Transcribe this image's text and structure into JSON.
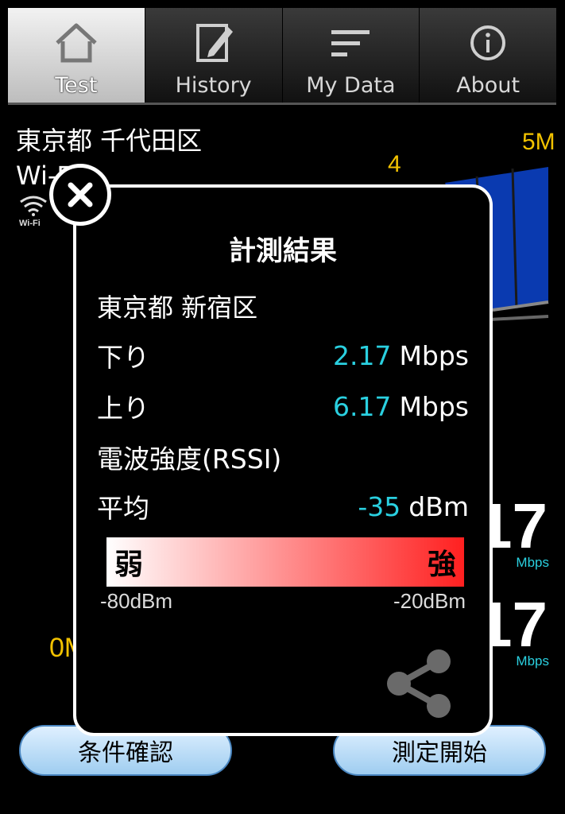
{
  "tabs": [
    {
      "label": "Test",
      "icon": "home-icon",
      "active": true
    },
    {
      "label": "History",
      "icon": "edit-icon",
      "active": false
    },
    {
      "label": "My Data",
      "icon": "list-icon",
      "active": false
    },
    {
      "label": "About",
      "icon": "info-icon",
      "active": false
    }
  ],
  "background": {
    "location": "東京都 千代田区",
    "network": "Wi-Fi",
    "wifi_label": "Wi-Fi",
    "gauge": {
      "tick_4": "4",
      "tick_5": "5M",
      "tick_0": "0M"
    },
    "download_speed_partial": "17",
    "upload_speed_partial": "17",
    "unit": "Mbps"
  },
  "buttons": {
    "check_conditions": "条件確認",
    "start_measurement": "測定開始"
  },
  "modal": {
    "title": "計測結果",
    "location": "東京都 新宿区",
    "download": {
      "label": "下り",
      "value": "2.17",
      "unit": "Mbps"
    },
    "upload": {
      "label": "上り",
      "value": "6.17",
      "unit": "Mbps"
    },
    "rssi_heading": "電波強度(RSSI)",
    "average": {
      "label": "平均",
      "value": "-35",
      "unit": "dBm"
    },
    "scale": {
      "weak": "弱",
      "strong": "強",
      "min": "-80dBm",
      "max": "-20dBm"
    }
  },
  "colors": {
    "accent": "#2ad0e0",
    "gauge_yellow": "#f2c200",
    "gauge_blue": "#0a3ab0",
    "button_fill": "#bfe0f8"
  }
}
